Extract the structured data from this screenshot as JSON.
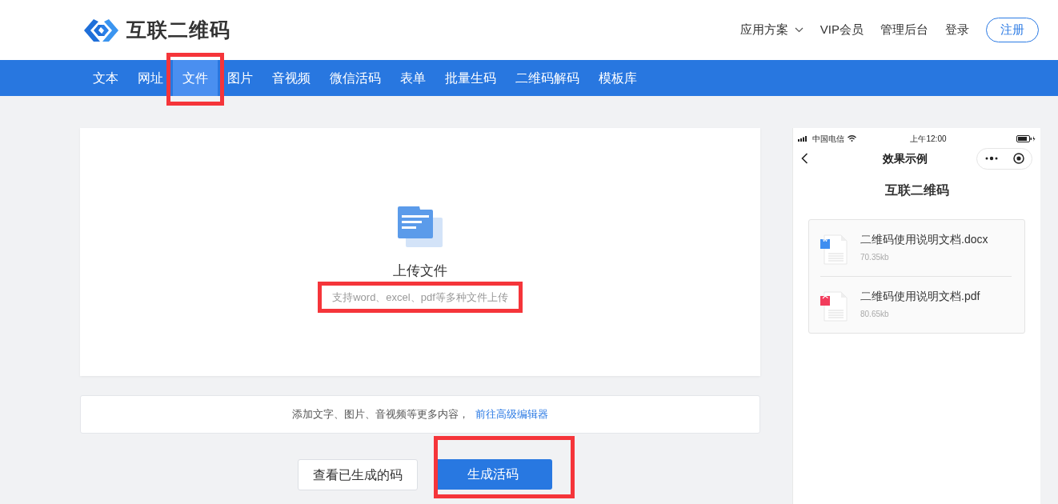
{
  "header": {
    "logo_text": "互联二维码",
    "links": [
      {
        "label": "应用方案",
        "dropdown": true
      },
      {
        "label": "VIP会员",
        "dropdown": false
      },
      {
        "label": "管理后台",
        "dropdown": false
      },
      {
        "label": "登录",
        "dropdown": false
      }
    ],
    "register_button": "注册"
  },
  "tabs": [
    {
      "label": "文本",
      "selected": false,
      "highlighted": false
    },
    {
      "label": "网址",
      "selected": false,
      "highlighted": false
    },
    {
      "label": "文件",
      "selected": true,
      "highlighted": true
    },
    {
      "label": "图片",
      "selected": false,
      "highlighted": false
    },
    {
      "label": "音视频",
      "selected": false,
      "highlighted": false
    },
    {
      "label": "微信活码",
      "selected": false,
      "highlighted": false
    },
    {
      "label": "表单",
      "selected": false,
      "highlighted": false
    },
    {
      "label": "批量生码",
      "selected": false,
      "highlighted": false
    },
    {
      "label": "二维码解码",
      "selected": false,
      "highlighted": false
    },
    {
      "label": "模板库",
      "selected": false,
      "highlighted": false
    }
  ],
  "upload": {
    "title": "上传文件",
    "hint": "支持word、excel、pdf等多种文件上传",
    "hint_highlighted": true
  },
  "more_content": {
    "text": "添加文字、图片、音视频等更多内容，",
    "link": "前往高级编辑器"
  },
  "buttons": [
    {
      "label": "查看已生成的码",
      "kind": "secondary",
      "highlighted": false
    },
    {
      "label": "生成活码",
      "kind": "primary",
      "highlighted": true
    }
  ],
  "preview": {
    "carrier": "中国电信",
    "time": "上午12:00",
    "page_title": "效果示例",
    "heading": "互联二维码",
    "files": [
      {
        "name": "二维码使用说明文档.docx",
        "size": "70.35kb",
        "kind": "word"
      },
      {
        "name": "二维码使用说明文档.pdf",
        "size": "80.65kb",
        "kind": "pdf"
      }
    ]
  }
}
